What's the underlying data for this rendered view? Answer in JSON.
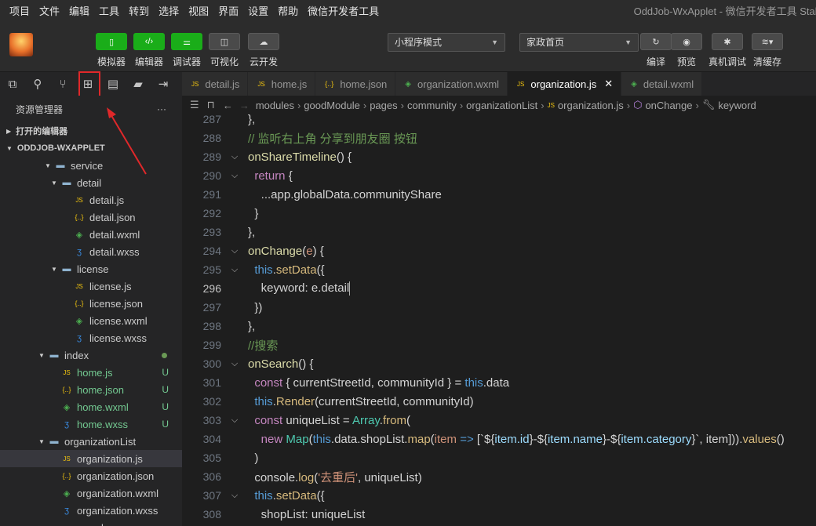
{
  "menu": [
    "项目",
    "文件",
    "编辑",
    "工具",
    "转到",
    "选择",
    "视图",
    "界面",
    "设置",
    "帮助",
    "微信开发者工具"
  ],
  "window_title": "OddJob-WxApplet - 微信开发者工具 Stab",
  "toolbar": {
    "buttons": [
      {
        "label": "模拟器",
        "icon": "phone-icon"
      },
      {
        "label": "编辑器",
        "icon": "code-icon"
      },
      {
        "label": "调试器",
        "icon": "debug-toggle-icon"
      },
      {
        "label": "可视化",
        "icon": "layout-icon"
      },
      {
        "label": "云开发",
        "icon": "cloud-icon"
      }
    ],
    "mode_select": "小程序模式",
    "page_select": "家政首页",
    "right_buttons": [
      {
        "label": "编译",
        "icon": "refresh-icon"
      },
      {
        "label": "预览",
        "icon": "eye-icon"
      },
      {
        "label": "真机调试",
        "icon": "bug-icon"
      },
      {
        "label": "清缓存",
        "icon": "layers-icon"
      }
    ]
  },
  "explorer": {
    "title": "资源管理器",
    "more": "···",
    "open_editors": "打开的编辑器",
    "project": "ODDJOB-WXAPPLET"
  },
  "tree": [
    {
      "indent": 60,
      "twisty": "▼",
      "icon": "folder",
      "name": "service",
      "status": ""
    },
    {
      "indent": 68,
      "twisty": "▼",
      "icon": "folder",
      "name": "detail",
      "status": ""
    },
    {
      "indent": 84,
      "twisty": "",
      "icon": "js",
      "name": "detail.js",
      "status": ""
    },
    {
      "indent": 84,
      "twisty": "",
      "icon": "json",
      "name": "detail.json",
      "status": ""
    },
    {
      "indent": 84,
      "twisty": "",
      "icon": "wxml",
      "name": "detail.wxml",
      "status": ""
    },
    {
      "indent": 84,
      "twisty": "",
      "icon": "wxss",
      "name": "detail.wxss",
      "status": ""
    },
    {
      "indent": 68,
      "twisty": "▼",
      "icon": "folder",
      "name": "license",
      "status": ""
    },
    {
      "indent": 84,
      "twisty": "",
      "icon": "js",
      "name": "license.js",
      "status": ""
    },
    {
      "indent": 84,
      "twisty": "",
      "icon": "json",
      "name": "license.json",
      "status": ""
    },
    {
      "indent": 84,
      "twisty": "",
      "icon": "wxml",
      "name": "license.wxml",
      "status": ""
    },
    {
      "indent": 84,
      "twisty": "",
      "icon": "wxss",
      "name": "license.wxss",
      "status": ""
    },
    {
      "indent": 52,
      "twisty": "▼",
      "icon": "folder",
      "name": "index",
      "status": "dot"
    },
    {
      "indent": 68,
      "twisty": "",
      "icon": "js",
      "name": "home.js",
      "status": "U"
    },
    {
      "indent": 68,
      "twisty": "",
      "icon": "json",
      "name": "home.json",
      "status": "U"
    },
    {
      "indent": 68,
      "twisty": "",
      "icon": "wxml",
      "name": "home.wxml",
      "status": "U"
    },
    {
      "indent": 68,
      "twisty": "",
      "icon": "wxss",
      "name": "home.wxss",
      "status": "U"
    },
    {
      "indent": 52,
      "twisty": "▼",
      "icon": "folder",
      "name": "organizationList",
      "status": ""
    },
    {
      "indent": 68,
      "twisty": "",
      "icon": "js",
      "name": "organization.js",
      "status": "",
      "selected": true
    },
    {
      "indent": 68,
      "twisty": "",
      "icon": "json",
      "name": "organization.json",
      "status": ""
    },
    {
      "indent": 68,
      "twisty": "",
      "icon": "wxml",
      "name": "organization.wxml",
      "status": ""
    },
    {
      "indent": 68,
      "twisty": "",
      "icon": "wxss",
      "name": "organization.wxss",
      "status": ""
    },
    {
      "indent": 52,
      "twisty": "▶",
      "icon": "folder",
      "name": "personal",
      "status": ""
    }
  ],
  "tabs": [
    {
      "icon": "js",
      "name": "detail.js"
    },
    {
      "icon": "js",
      "name": "home.js"
    },
    {
      "icon": "json",
      "name": "home.json"
    },
    {
      "icon": "wxml",
      "name": "organization.wxml"
    },
    {
      "icon": "js",
      "name": "organization.js",
      "active": true
    },
    {
      "icon": "wxml",
      "name": "detail.wxml"
    }
  ],
  "breadcrumb": [
    "modules",
    "goodModule",
    "pages",
    "community",
    "organizationList",
    "organization.js",
    "onChange",
    "keyword"
  ],
  "code": {
    "current_line": 296,
    "lines": [
      {
        "n": 287,
        "fold": "",
        "tokens": [
          [
            "txt",
            "},"
          ]
        ]
      },
      {
        "n": 288,
        "fold": "",
        "tokens": [
          [
            "cm",
            "// 监听右上角 分享到朋友圈 按钮"
          ]
        ]
      },
      {
        "n": 289,
        "fold": "v",
        "tokens": [
          [
            "fn",
            "onShareTimeline"
          ],
          [
            "txt",
            "() {"
          ]
        ]
      },
      {
        "n": 290,
        "fold": "v",
        "tokens": [
          [
            "txt",
            "  "
          ],
          [
            "kw2",
            "return"
          ],
          [
            "txt",
            " {"
          ]
        ]
      },
      {
        "n": 291,
        "fold": "",
        "tokens": [
          [
            "txt",
            "    ...app.globalData.communityShare"
          ]
        ]
      },
      {
        "n": 292,
        "fold": "",
        "tokens": [
          [
            "txt",
            "  }"
          ]
        ]
      },
      {
        "n": 293,
        "fold": "",
        "tokens": [
          [
            "txt",
            "},"
          ]
        ]
      },
      {
        "n": 294,
        "fold": "v",
        "tokens": [
          [
            "fn",
            "onChange"
          ],
          [
            "txt",
            "("
          ],
          [
            "pm",
            "e"
          ],
          [
            "txt",
            ") {"
          ]
        ]
      },
      {
        "n": 295,
        "fold": "v",
        "tokens": [
          [
            "txt",
            "  "
          ],
          [
            "kw",
            "this"
          ],
          [
            "txt",
            "."
          ],
          [
            "fnc",
            "setData"
          ],
          [
            "txt",
            "({"
          ]
        ]
      },
      {
        "n": 296,
        "fold": "",
        "tokens": [
          [
            "txt",
            "    keyword: e.detail"
          ]
        ]
      },
      {
        "n": 297,
        "fold": "",
        "tokens": [
          [
            "txt",
            "  })"
          ]
        ]
      },
      {
        "n": 298,
        "fold": "",
        "tokens": [
          [
            "txt",
            "},"
          ]
        ]
      },
      {
        "n": 299,
        "fold": "",
        "tokens": [
          [
            "cm",
            "//搜索"
          ]
        ]
      },
      {
        "n": 300,
        "fold": "v",
        "tokens": [
          [
            "fn",
            "onSearch"
          ],
          [
            "txt",
            "() {"
          ]
        ]
      },
      {
        "n": 301,
        "fold": "",
        "tokens": [
          [
            "txt",
            "  "
          ],
          [
            "kw2",
            "const"
          ],
          [
            "txt",
            " { currentStreetId, communityId } = "
          ],
          [
            "kw",
            "this"
          ],
          [
            "txt",
            ".data"
          ]
        ]
      },
      {
        "n": 302,
        "fold": "",
        "tokens": [
          [
            "txt",
            "  "
          ],
          [
            "kw",
            "this"
          ],
          [
            "txt",
            "."
          ],
          [
            "fnc",
            "Render"
          ],
          [
            "txt",
            "(currentStreetId, communityId)"
          ]
        ]
      },
      {
        "n": 303,
        "fold": "v",
        "tokens": [
          [
            "txt",
            "  "
          ],
          [
            "kw2",
            "const"
          ],
          [
            "txt",
            " uniqueList = "
          ],
          [
            "cls",
            "Array"
          ],
          [
            "txt",
            "."
          ],
          [
            "fnc",
            "from"
          ],
          [
            "txt",
            "("
          ]
        ]
      },
      {
        "n": 304,
        "fold": "",
        "tokens": [
          [
            "txt",
            "    "
          ],
          [
            "kw2",
            "new"
          ],
          [
            "txt",
            " "
          ],
          [
            "cls",
            "Map"
          ],
          [
            "txt",
            "("
          ],
          [
            "kw",
            "this"
          ],
          [
            "txt",
            ".data.shopList."
          ],
          [
            "fnc",
            "map"
          ],
          [
            "txt",
            "("
          ],
          [
            "pm",
            "item"
          ],
          [
            "txt",
            " "
          ],
          [
            "kw",
            "=>"
          ],
          [
            "txt",
            " [`${"
          ],
          [
            "prop",
            "item.id"
          ],
          [
            "txt",
            "}-${"
          ],
          [
            "prop",
            "item.name"
          ],
          [
            "txt",
            "}-${"
          ],
          [
            "prop",
            "item.category"
          ],
          [
            "txt",
            "}`, item]))."
          ],
          [
            "fnc",
            "values"
          ],
          [
            "txt",
            "()"
          ]
        ]
      },
      {
        "n": 305,
        "fold": "",
        "tokens": [
          [
            "txt",
            "  )"
          ]
        ]
      },
      {
        "n": 306,
        "fold": "",
        "tokens": [
          [
            "txt",
            "  console."
          ],
          [
            "fnc",
            "log"
          ],
          [
            "txt",
            "("
          ],
          [
            "str",
            "'去重后'"
          ],
          [
            "txt",
            ", uniqueList)"
          ]
        ]
      },
      {
        "n": 307,
        "fold": "v",
        "tokens": [
          [
            "txt",
            "  "
          ],
          [
            "kw",
            "this"
          ],
          [
            "txt",
            "."
          ],
          [
            "fnc",
            "setData"
          ],
          [
            "txt",
            "({"
          ]
        ]
      },
      {
        "n": 308,
        "fold": "",
        "tokens": [
          [
            "txt",
            "    shopList: uniqueList"
          ]
        ]
      }
    ]
  },
  "colors": {
    "accent_green": "#1aad19",
    "annotation_red": "#e0282a"
  }
}
